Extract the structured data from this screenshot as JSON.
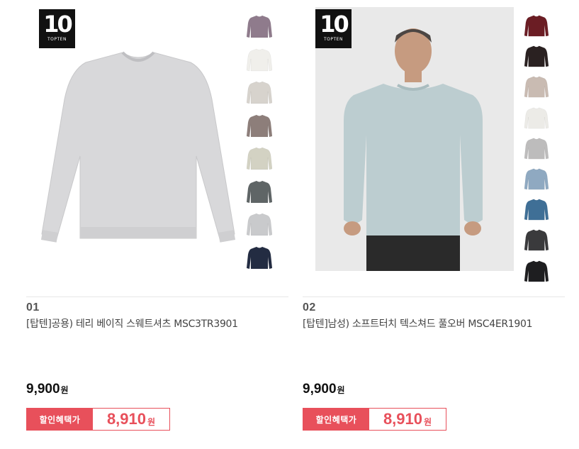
{
  "products": [
    {
      "brand_logo": {
        "number": "10",
        "text": "TOPTEN"
      },
      "index": "01",
      "title": "[탑텐]공용) 테리 베이직 스웨트셔츠 MSC3TR3901",
      "price": "9,900",
      "price_unit": "원",
      "sale_label": "할인혜택가",
      "sale_price": "8,910",
      "sale_unit": "원",
      "main_color": "#d6d6d8",
      "swatches": [
        "#8f7b8c",
        "#f0efeb",
        "#d7d3cd",
        "#8d7e7a",
        "#d3d2c3",
        "#5f6566",
        "#c9cacc",
        "#232c42"
      ]
    },
    {
      "brand_logo": {
        "number": "10",
        "text": "TOPTEN"
      },
      "index": "02",
      "title": "[탑텐]남성) 소프트터치 텍스쳐드 풀오버 MSC4ER1901",
      "price": "9,900",
      "price_unit": "원",
      "sale_label": "할인혜택가",
      "sale_price": "8,910",
      "sale_unit": "원",
      "main_color": "#bccdd0",
      "swatches": [
        "#6b1d24",
        "#2a2121",
        "#c9bbb2",
        "#ecebe7",
        "#bdbcbc",
        "#8fa9c1",
        "#3f6f96",
        "#3a3a3c",
        "#1e1e20"
      ]
    }
  ]
}
